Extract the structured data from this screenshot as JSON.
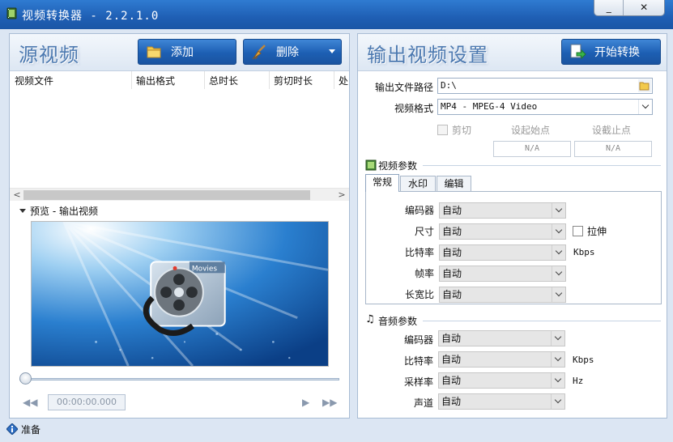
{
  "window": {
    "title": "视频转换器 - 2.2.1.0",
    "minimize_glyph": "_",
    "close_glyph": "✕"
  },
  "source": {
    "title": "源视频",
    "add_label": "添加",
    "delete_label": "删除",
    "columns": [
      "视频文件",
      "输出格式",
      "总时长",
      "剪切时长",
      "处"
    ],
    "scroll_left": "<",
    "scroll_right": ">",
    "preview_label": "预览 - 输出视频",
    "time": "00:00:00.000"
  },
  "output": {
    "title": "输出视频设置",
    "start_label": "开始转换",
    "path_label": "输出文件路径",
    "path_value": "D:\\",
    "format_label": "视频格式",
    "format_value": "MP4 - MPEG-4 Video",
    "cut_label": "剪切",
    "start_point_label": "设起始点",
    "end_point_label": "设截止点",
    "start_point_value": "N/A",
    "end_point_value": "N/A"
  },
  "video_params": {
    "title": "视频参数",
    "tabs": [
      "常规",
      "水印",
      "编辑"
    ],
    "active_tab": 0,
    "rows": [
      {
        "label": "编码器",
        "value": "自动"
      },
      {
        "label": "尺寸",
        "value": "自动"
      },
      {
        "label": "比特率",
        "value": "自动"
      },
      {
        "label": "帧率",
        "value": "自动"
      },
      {
        "label": "长宽比",
        "value": "自动"
      }
    ],
    "stretch_label": "拉伸",
    "bitrate_unit": "Kbps"
  },
  "audio_params": {
    "title": "音频参数",
    "rows": [
      {
        "label": "编码器",
        "value": "自动"
      },
      {
        "label": "比特率",
        "value": "自动"
      },
      {
        "label": "采样率",
        "value": "自动"
      },
      {
        "label": "声道",
        "value": "自动"
      }
    ],
    "bitrate_unit": "Kbps",
    "samplerate_unit": "Hz"
  },
  "status": {
    "text": "准备"
  },
  "colors": {
    "titlebar": "#1f5fb4",
    "accent_button": "#1d5fb3",
    "panel_border": "#a9bcd4"
  }
}
